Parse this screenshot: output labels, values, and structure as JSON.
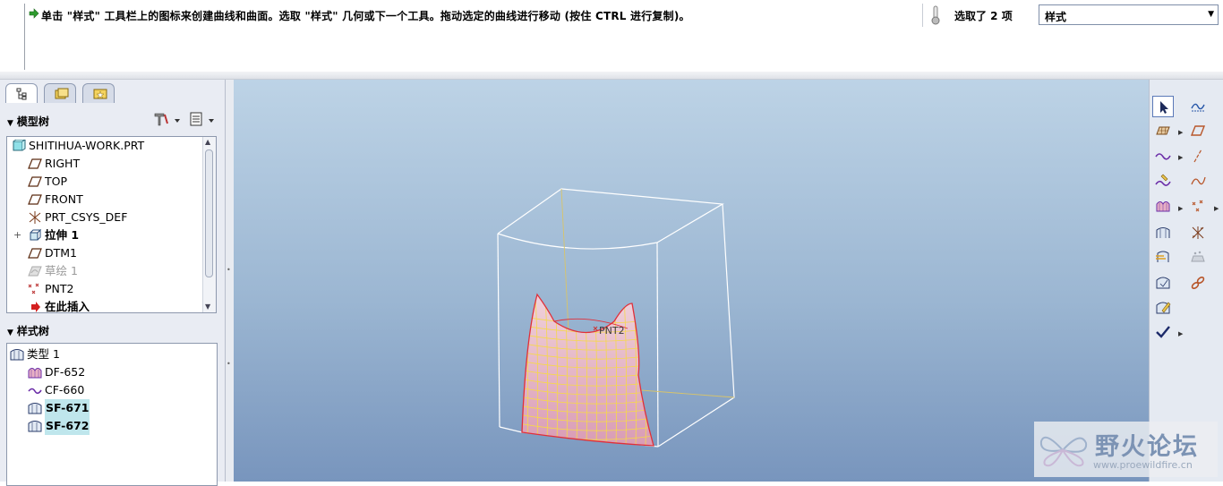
{
  "message_bar": {
    "prompt": "单击 \"样式\" 工具栏上的图标来创建曲线和曲面。选取 \"样式\" 几何或下一个工具。拖动选定的曲线进行移动 (按住 CTRL 进行复制)。",
    "selection_count": "选取了 2 项",
    "filter_value": "样式"
  },
  "model_tree": {
    "title": "模型树",
    "items": [
      {
        "label": "SHITIHUA-WORK.PRT",
        "icon": "part-icon"
      },
      {
        "label": "RIGHT",
        "icon": "datum-plane-icon"
      },
      {
        "label": "TOP",
        "icon": "datum-plane-icon"
      },
      {
        "label": "FRONT",
        "icon": "datum-plane-icon"
      },
      {
        "label": "PRT_CSYS_DEF",
        "icon": "csys-icon"
      },
      {
        "label": "拉伸 1",
        "icon": "extrude-icon"
      },
      {
        "label": "DTM1",
        "icon": "datum-plane-icon"
      },
      {
        "label": "草绘 1",
        "icon": "sketch-icon"
      },
      {
        "label": "PNT2",
        "icon": "datum-point-icon"
      },
      {
        "label": "在此插入",
        "icon": "insert-here-arrow-icon"
      }
    ]
  },
  "style_tree": {
    "title": "样式树",
    "items": [
      {
        "label": "类型 1",
        "icon": "style-type-icon"
      },
      {
        "label": "DF-652",
        "icon": "draft-surface-icon"
      },
      {
        "label": "CF-660",
        "icon": "curve-icon"
      },
      {
        "label": "SF-671",
        "icon": "surface-icon",
        "highlighted": true
      },
      {
        "label": "SF-672",
        "icon": "surface-icon",
        "highlighted": true
      }
    ]
  },
  "viewport": {
    "point_label": "PNT2"
  },
  "watermark": {
    "title": "野火论坛",
    "url": "www.proewildfire.cn"
  },
  "colors": {
    "viewport_top": "#bdd3e6",
    "viewport_bottom": "#7895bd",
    "surface_edge": "#e0303a",
    "surface_mesh": "#f6d84a",
    "surface_fill": "#e8b0c4",
    "highlight": "#bfe6ec"
  }
}
